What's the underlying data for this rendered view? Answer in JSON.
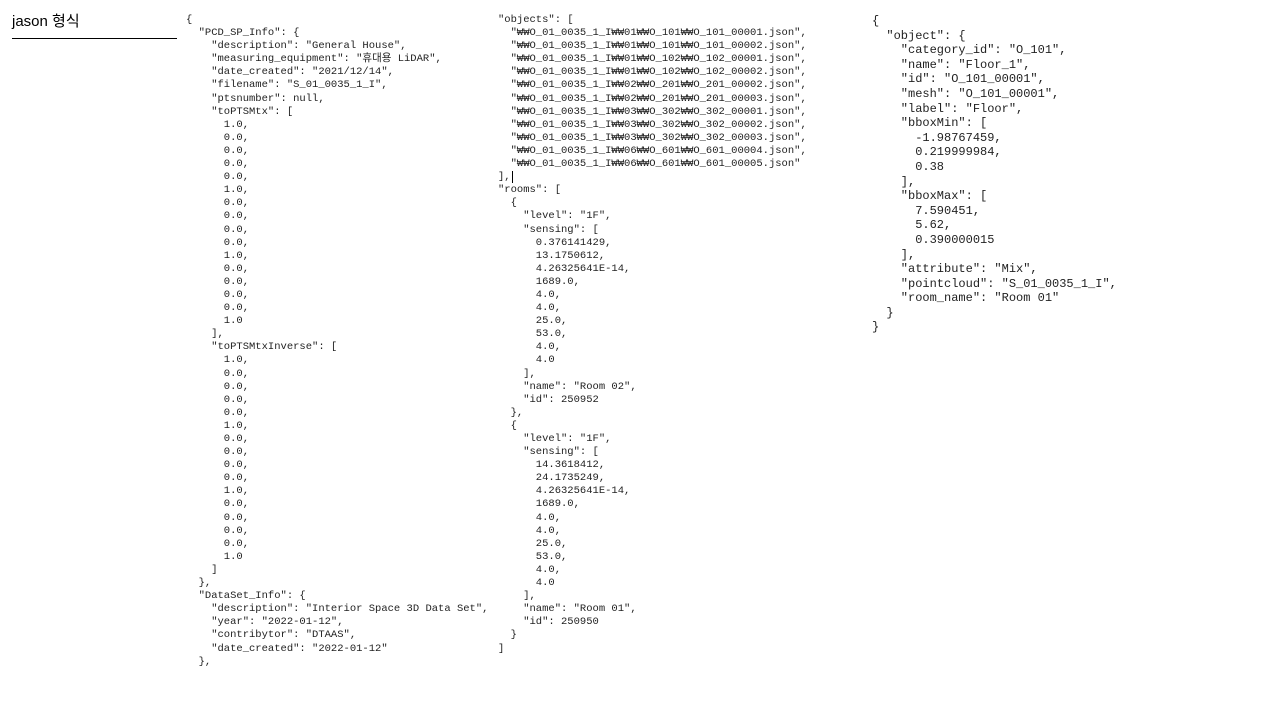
{
  "header": "jason 형식",
  "col1_lines": [
    "{",
    "  \"PCD_SP_Info\": {",
    "    \"description\": \"General House\",",
    "    \"measuring_equipment\": \"휴대용 LiDAR\",",
    "    \"date_created\": \"2021/12/14\",",
    "    \"filename\": \"S_01_0035_1_I\",",
    "    \"ptsnumber\": null,",
    "    \"toPTSMtx\": [",
    "      1.0,",
    "      0.0,",
    "      0.0,",
    "      0.0,",
    "      0.0,",
    "      1.0,",
    "      0.0,",
    "      0.0,",
    "      0.0,",
    "      0.0,",
    "      1.0,",
    "      0.0,",
    "      0.0,",
    "      0.0,",
    "      0.0,",
    "      1.0",
    "    ],",
    "    \"toPTSMtxInverse\": [",
    "      1.0,",
    "      0.0,",
    "      0.0,",
    "      0.0,",
    "      0.0,",
    "      1.0,",
    "      0.0,",
    "      0.0,",
    "      0.0,",
    "      0.0,",
    "      1.0,",
    "      0.0,",
    "      0.0,",
    "      0.0,",
    "      0.0,",
    "      1.0",
    "    ]",
    "  },",
    "  \"DataSet_Info\": {",
    "    \"description\": \"Interior Space 3D Data Set\",",
    "    \"year\": \"2022-01-12\",",
    "    \"contribytor\": \"DTAAS\",",
    "    \"date_created\": \"2022-01-12\"",
    "  },"
  ],
  "col2_lines": [
    "\"objects\": [",
    "  \"\\\\O_01_0035_1_I\\\\01\\\\O_101\\\\O_101_00001.json\",",
    "  \"\\\\O_01_0035_1_I\\\\01\\\\O_101\\\\O_101_00002.json\",",
    "  \"\\\\O_01_0035_1_I\\\\01\\\\O_102\\\\O_102_00001.json\",",
    "  \"\\\\O_01_0035_1_I\\\\01\\\\O_102\\\\O_102_00002.json\",",
    "  \"\\\\O_01_0035_1_I\\\\02\\\\O_201\\\\O_201_00002.json\",",
    "  \"\\\\O_01_0035_1_I\\\\02\\\\O_201\\\\O_201_00003.json\",",
    "  \"\\\\O_01_0035_1_I\\\\03\\\\O_302\\\\O_302_00001.json\",",
    "  \"\\\\O_01_0035_1_I\\\\03\\\\O_302\\\\O_302_00002.json\",",
    "  \"\\\\O_01_0035_1_I\\\\03\\\\O_302\\\\O_302_00003.json\",",
    "  \"\\\\O_01_0035_1_I\\\\06\\\\O_601\\\\O_601_00004.json\",",
    "  \"\\\\O_01_0035_1_I\\\\06\\\\O_601\\\\O_601_00005.json\"",
    "],|",
    "\"rooms\": [",
    "  {",
    "    \"level\": \"1F\",",
    "    \"sensing\": [",
    "      0.376141429,",
    "      13.1750612,",
    "      4.26325641E-14,",
    "      1689.0,",
    "      4.0,",
    "      4.0,",
    "      25.0,",
    "      53.0,",
    "      4.0,",
    "      4.0",
    "    ],",
    "    \"name\": \"Room 02\",",
    "    \"id\": 250952",
    "  },",
    "  {",
    "    \"level\": \"1F\",",
    "    \"sensing\": [",
    "      14.3618412,",
    "      24.1735249,",
    "      4.26325641E-14,",
    "      1689.0,",
    "      4.0,",
    "      4.0,",
    "      25.0,",
    "      53.0,",
    "      4.0,",
    "      4.0",
    "    ],",
    "    \"name\": \"Room 01\",",
    "    \"id\": 250950",
    "  }",
    "]"
  ],
  "col3_lines": [
    "{",
    "  \"object\": {",
    "    \"category_id\": \"O_101\",",
    "    \"name\": \"Floor_1\",",
    "    \"id\": \"O_101_00001\",",
    "    \"mesh\": \"O_101_00001\",",
    "    \"label\": \"Floor\",",
    "    \"bboxMin\": [",
    "      -1.98767459,",
    "      0.219999984,",
    "      0.38",
    "    ],",
    "    \"bboxMax\": [",
    "      7.590451,",
    "      5.62,",
    "      0.390000015",
    "    ],",
    "    \"attribute\": \"Mix\",",
    "    \"pointcloud\": \"S_01_0035_1_I\",",
    "    \"room_name\": \"Room 01\"",
    "  }",
    "}"
  ]
}
